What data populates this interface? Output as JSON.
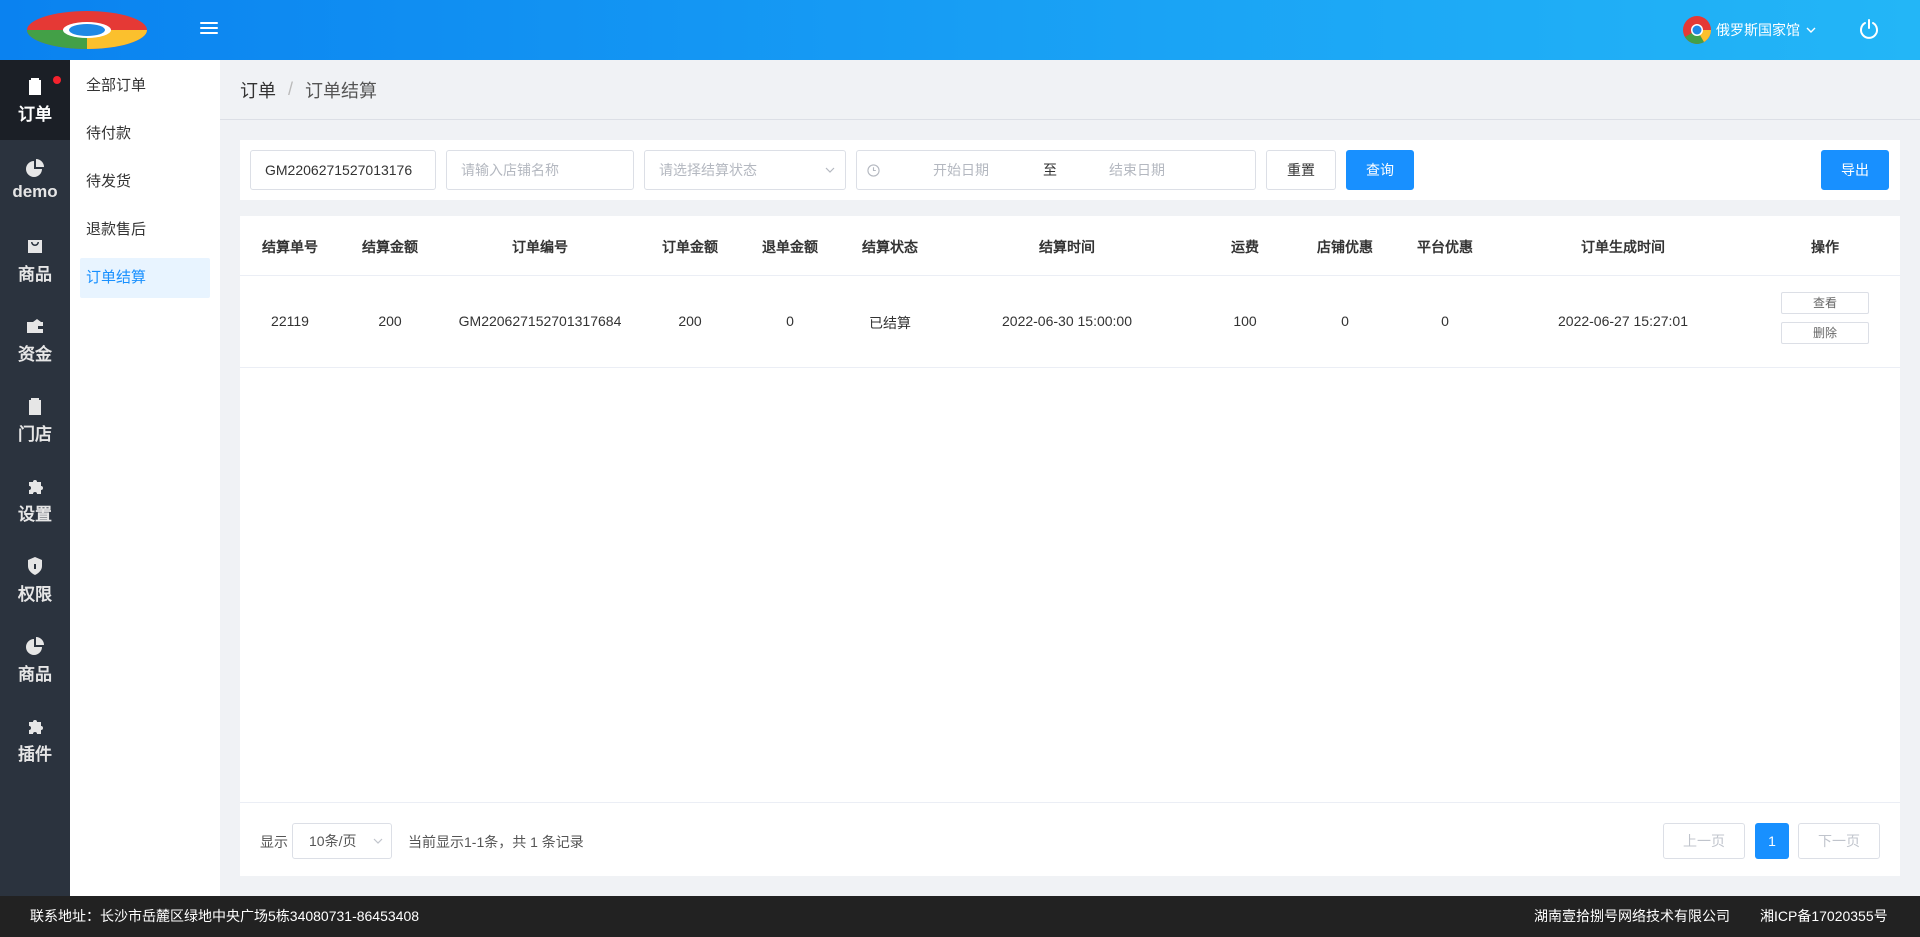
{
  "header": {
    "store_name": "俄罗斯国家馆"
  },
  "iconbar": {
    "items": [
      {
        "label": "订单",
        "icon": "clipboard-icon",
        "active": true
      },
      {
        "label": "demo",
        "icon": "pie-chart-icon"
      },
      {
        "label": "商品",
        "icon": "bag-icon"
      },
      {
        "label": "资金",
        "icon": "wallet-icon"
      },
      {
        "label": "门店",
        "icon": "clipboard-list-icon"
      },
      {
        "label": "设置",
        "icon": "puzzle-icon"
      },
      {
        "label": "权限",
        "icon": "shield-icon"
      },
      {
        "label": "商品",
        "icon": "pie-chart-icon"
      },
      {
        "label": "插件",
        "icon": "puzzle-icon"
      }
    ]
  },
  "submenu": {
    "items": [
      {
        "label": "全部订单"
      },
      {
        "label": "待付款"
      },
      {
        "label": "待发货"
      },
      {
        "label": "退款售后"
      },
      {
        "label": "订单结算",
        "active": true
      }
    ]
  },
  "breadcrumb": {
    "parent": "订单",
    "separator": "/",
    "current": "订单结算"
  },
  "filters": {
    "order_no_value": "GM2206271527013176",
    "store_placeholder": "请输入店铺名称",
    "status_placeholder": "请选择结算状态",
    "start_date_placeholder": "开始日期",
    "date_to": "至",
    "end_date_placeholder": "结束日期",
    "reset_label": "重置",
    "query_label": "查询",
    "export_label": "导出"
  },
  "table": {
    "columns": [
      "结算单号",
      "结算金额",
      "订单编号",
      "订单金额",
      "退单金额",
      "结算状态",
      "结算时间",
      "运费",
      "店铺优惠",
      "平台优惠",
      "订单生成时间",
      "操作"
    ],
    "rows": [
      {
        "cells": [
          "22119",
          "200",
          "GM220627152701317684",
          "200",
          "0",
          "已结算",
          "2022-06-30 15:00:00",
          "100",
          "0",
          "0",
          "2022-06-27 15:27:01"
        ],
        "actions": {
          "view": "查看",
          "delete": "删除"
        }
      }
    ]
  },
  "pagination": {
    "show_label": "显示",
    "page_size": "10条/页",
    "summary": "当前显示1-1条，共 1 条记录",
    "prev_label": "上一页",
    "current_page": "1",
    "next_label": "下一页"
  },
  "footer": {
    "address": "联系地址：长沙市岳麓区绿地中央广场5栋34080731-86453408",
    "company": "湖南壹拾捌号网络技术有限公司",
    "icp": "湘ICP备17020355号"
  },
  "colors": {
    "primary": "#1890ff",
    "sidebar_bg": "#2b333e",
    "footer_bg": "#222222",
    "badge_red": "#f5222d"
  }
}
